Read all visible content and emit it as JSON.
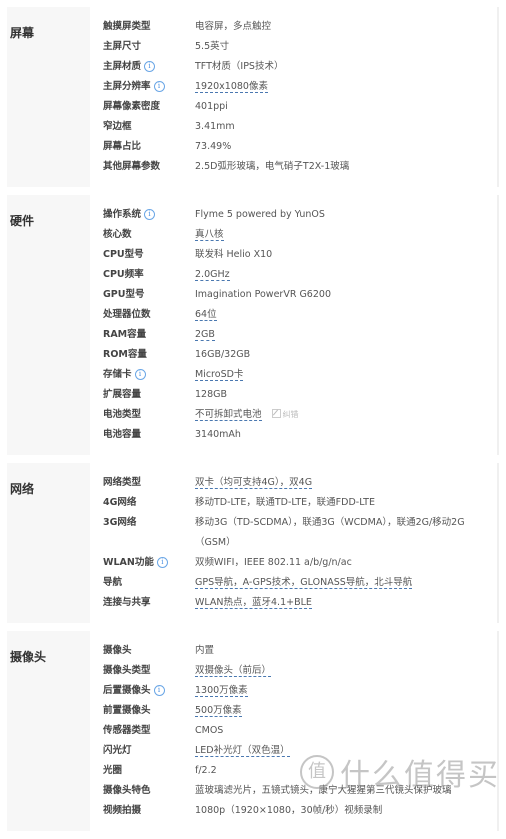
{
  "sections": [
    {
      "title": "屏幕",
      "rows": [
        {
          "key": "触摸屏类型",
          "value": "电容屏，多点触控"
        },
        {
          "key": "主屏尺寸",
          "value": "5.5英寸"
        },
        {
          "key": "主屏材质",
          "info": true,
          "value": "TFT材质（IPS技术）"
        },
        {
          "key": "主屏分辨率",
          "info": true,
          "value": "1920x1080像素",
          "underline": true
        },
        {
          "key": "屏幕像素密度",
          "value": "401ppi"
        },
        {
          "key": "窄边框",
          "value": "3.41mm"
        },
        {
          "key": "屏幕占比",
          "value": "73.49%"
        },
        {
          "key": "其他屏幕参数",
          "value": "2.5D弧形玻璃，电气硝子T2X-1玻璃"
        }
      ]
    },
    {
      "title": "硬件",
      "rows": [
        {
          "key": "操作系统",
          "info": true,
          "value": "Flyme 5 powered by YunOS"
        },
        {
          "key": "核心数",
          "value": "真八核",
          "underline": true
        },
        {
          "key": "CPU型号",
          "value": "联发科 Helio X10"
        },
        {
          "key": "CPU频率",
          "value": "2.0GHz",
          "underline": true
        },
        {
          "key": "GPU型号",
          "value": "Imagination PowerVR G6200"
        },
        {
          "key": "处理器位数",
          "value": "64位",
          "underline": true
        },
        {
          "key": "RAM容量",
          "value": "2GB",
          "underline": true
        },
        {
          "key": "ROM容量",
          "value": "16GB/32GB"
        },
        {
          "key": "存储卡",
          "info": true,
          "value": "MicroSD卡",
          "underline": true
        },
        {
          "key": "扩展容量",
          "value": "128GB"
        },
        {
          "key": "电池类型",
          "value": "不可拆卸式电池",
          "underline": true,
          "fix": "纠错"
        },
        {
          "key": "电池容量",
          "value": "3140mAh"
        }
      ]
    },
    {
      "title": "网络",
      "rows": [
        {
          "key": "网络类型",
          "value": "双卡（均可支持4G），双4G",
          "underline": true
        },
        {
          "key": "4G网络",
          "value": "移动TD-LTE，联通TD-LTE，联通FDD-LTE"
        },
        {
          "key": "3G网络",
          "value": "移动3G（TD-SCDMA），联通3G（WCDMA），联通2G/移动2G（GSM）"
        },
        {
          "key": "WLAN功能",
          "info": true,
          "value": "双频WIFI，IEEE 802.11 a/b/g/n/ac"
        },
        {
          "key": "导航",
          "value": "GPS导航，A-GPS技术，GLONASS导航，北斗导航",
          "underline": true
        },
        {
          "key": "连接与共享",
          "value": "WLAN热点，蓝牙4.1+BLE",
          "underline": true
        }
      ]
    },
    {
      "title": "摄像头",
      "rows": [
        {
          "key": "摄像头",
          "value": "内置"
        },
        {
          "key": "摄像头类型",
          "value": "双摄像头（前后）",
          "underline": true
        },
        {
          "key": "后置摄像头",
          "info": true,
          "value": "1300万像素",
          "underline": true
        },
        {
          "key": "前置摄像头",
          "value": "500万像素",
          "underline": true
        },
        {
          "key": "传感器类型",
          "value": "CMOS"
        },
        {
          "key": "闪光灯",
          "value": "LED补光灯（双色温）",
          "underline": true
        },
        {
          "key": "光圈",
          "value": "f/2.2"
        },
        {
          "key": "摄像头特色",
          "value": "蓝玻璃滤光片，五镜式镜头，康宁大猩猩第三代镜头保护玻璃"
        },
        {
          "key": "视频拍摄",
          "value": "1080p（1920×1080，30帧/秒）视频录制"
        }
      ]
    }
  ],
  "watermark": {
    "badge": "值",
    "text": "什么值得买"
  }
}
